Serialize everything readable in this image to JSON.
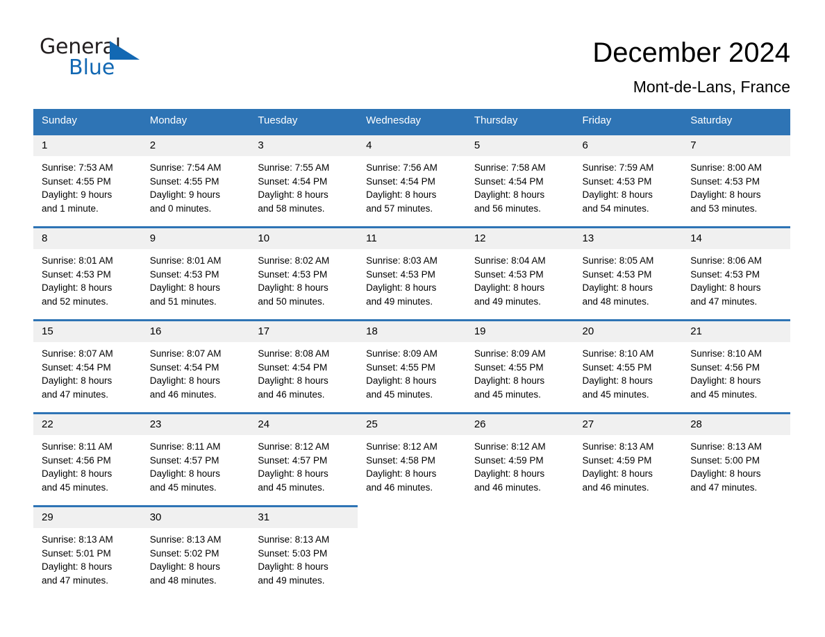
{
  "logo": {
    "word1": "General",
    "word2": "Blue",
    "triangle_color": "#1268b3"
  },
  "header": {
    "title": "December 2024",
    "subtitle": "Mont-de-Lans, France"
  },
  "theme": {
    "header_blue": "#2e74b5",
    "daynum_bg": "#f0f0f0",
    "page_bg": "#ffffff",
    "text": "#000000"
  },
  "weekdays": [
    "Sunday",
    "Monday",
    "Tuesday",
    "Wednesday",
    "Thursday",
    "Friday",
    "Saturday"
  ],
  "weeks": [
    [
      {
        "day": "1",
        "sunrise": "Sunrise: 7:53 AM",
        "sunset": "Sunset: 4:55 PM",
        "daylight1": "Daylight: 9 hours",
        "daylight2": "and 1 minute."
      },
      {
        "day": "2",
        "sunrise": "Sunrise: 7:54 AM",
        "sunset": "Sunset: 4:55 PM",
        "daylight1": "Daylight: 9 hours",
        "daylight2": "and 0 minutes."
      },
      {
        "day": "3",
        "sunrise": "Sunrise: 7:55 AM",
        "sunset": "Sunset: 4:54 PM",
        "daylight1": "Daylight: 8 hours",
        "daylight2": "and 58 minutes."
      },
      {
        "day": "4",
        "sunrise": "Sunrise: 7:56 AM",
        "sunset": "Sunset: 4:54 PM",
        "daylight1": "Daylight: 8 hours",
        "daylight2": "and 57 minutes."
      },
      {
        "day": "5",
        "sunrise": "Sunrise: 7:58 AM",
        "sunset": "Sunset: 4:54 PM",
        "daylight1": "Daylight: 8 hours",
        "daylight2": "and 56 minutes."
      },
      {
        "day": "6",
        "sunrise": "Sunrise: 7:59 AM",
        "sunset": "Sunset: 4:53 PM",
        "daylight1": "Daylight: 8 hours",
        "daylight2": "and 54 minutes."
      },
      {
        "day": "7",
        "sunrise": "Sunrise: 8:00 AM",
        "sunset": "Sunset: 4:53 PM",
        "daylight1": "Daylight: 8 hours",
        "daylight2": "and 53 minutes."
      }
    ],
    [
      {
        "day": "8",
        "sunrise": "Sunrise: 8:01 AM",
        "sunset": "Sunset: 4:53 PM",
        "daylight1": "Daylight: 8 hours",
        "daylight2": "and 52 minutes."
      },
      {
        "day": "9",
        "sunrise": "Sunrise: 8:01 AM",
        "sunset": "Sunset: 4:53 PM",
        "daylight1": "Daylight: 8 hours",
        "daylight2": "and 51 minutes."
      },
      {
        "day": "10",
        "sunrise": "Sunrise: 8:02 AM",
        "sunset": "Sunset: 4:53 PM",
        "daylight1": "Daylight: 8 hours",
        "daylight2": "and 50 minutes."
      },
      {
        "day": "11",
        "sunrise": "Sunrise: 8:03 AM",
        "sunset": "Sunset: 4:53 PM",
        "daylight1": "Daylight: 8 hours",
        "daylight2": "and 49 minutes."
      },
      {
        "day": "12",
        "sunrise": "Sunrise: 8:04 AM",
        "sunset": "Sunset: 4:53 PM",
        "daylight1": "Daylight: 8 hours",
        "daylight2": "and 49 minutes."
      },
      {
        "day": "13",
        "sunrise": "Sunrise: 8:05 AM",
        "sunset": "Sunset: 4:53 PM",
        "daylight1": "Daylight: 8 hours",
        "daylight2": "and 48 minutes."
      },
      {
        "day": "14",
        "sunrise": "Sunrise: 8:06 AM",
        "sunset": "Sunset: 4:53 PM",
        "daylight1": "Daylight: 8 hours",
        "daylight2": "and 47 minutes."
      }
    ],
    [
      {
        "day": "15",
        "sunrise": "Sunrise: 8:07 AM",
        "sunset": "Sunset: 4:54 PM",
        "daylight1": "Daylight: 8 hours",
        "daylight2": "and 47 minutes."
      },
      {
        "day": "16",
        "sunrise": "Sunrise: 8:07 AM",
        "sunset": "Sunset: 4:54 PM",
        "daylight1": "Daylight: 8 hours",
        "daylight2": "and 46 minutes."
      },
      {
        "day": "17",
        "sunrise": "Sunrise: 8:08 AM",
        "sunset": "Sunset: 4:54 PM",
        "daylight1": "Daylight: 8 hours",
        "daylight2": "and 46 minutes."
      },
      {
        "day": "18",
        "sunrise": "Sunrise: 8:09 AM",
        "sunset": "Sunset: 4:55 PM",
        "daylight1": "Daylight: 8 hours",
        "daylight2": "and 45 minutes."
      },
      {
        "day": "19",
        "sunrise": "Sunrise: 8:09 AM",
        "sunset": "Sunset: 4:55 PM",
        "daylight1": "Daylight: 8 hours",
        "daylight2": "and 45 minutes."
      },
      {
        "day": "20",
        "sunrise": "Sunrise: 8:10 AM",
        "sunset": "Sunset: 4:55 PM",
        "daylight1": "Daylight: 8 hours",
        "daylight2": "and 45 minutes."
      },
      {
        "day": "21",
        "sunrise": "Sunrise: 8:10 AM",
        "sunset": "Sunset: 4:56 PM",
        "daylight1": "Daylight: 8 hours",
        "daylight2": "and 45 minutes."
      }
    ],
    [
      {
        "day": "22",
        "sunrise": "Sunrise: 8:11 AM",
        "sunset": "Sunset: 4:56 PM",
        "daylight1": "Daylight: 8 hours",
        "daylight2": "and 45 minutes."
      },
      {
        "day": "23",
        "sunrise": "Sunrise: 8:11 AM",
        "sunset": "Sunset: 4:57 PM",
        "daylight1": "Daylight: 8 hours",
        "daylight2": "and 45 minutes."
      },
      {
        "day": "24",
        "sunrise": "Sunrise: 8:12 AM",
        "sunset": "Sunset: 4:57 PM",
        "daylight1": "Daylight: 8 hours",
        "daylight2": "and 45 minutes."
      },
      {
        "day": "25",
        "sunrise": "Sunrise: 8:12 AM",
        "sunset": "Sunset: 4:58 PM",
        "daylight1": "Daylight: 8 hours",
        "daylight2": "and 46 minutes."
      },
      {
        "day": "26",
        "sunrise": "Sunrise: 8:12 AM",
        "sunset": "Sunset: 4:59 PM",
        "daylight1": "Daylight: 8 hours",
        "daylight2": "and 46 minutes."
      },
      {
        "day": "27",
        "sunrise": "Sunrise: 8:13 AM",
        "sunset": "Sunset: 4:59 PM",
        "daylight1": "Daylight: 8 hours",
        "daylight2": "and 46 minutes."
      },
      {
        "day": "28",
        "sunrise": "Sunrise: 8:13 AM",
        "sunset": "Sunset: 5:00 PM",
        "daylight1": "Daylight: 8 hours",
        "daylight2": "and 47 minutes."
      }
    ],
    [
      {
        "day": "29",
        "sunrise": "Sunrise: 8:13 AM",
        "sunset": "Sunset: 5:01 PM",
        "daylight1": "Daylight: 8 hours",
        "daylight2": "and 47 minutes."
      },
      {
        "day": "30",
        "sunrise": "Sunrise: 8:13 AM",
        "sunset": "Sunset: 5:02 PM",
        "daylight1": "Daylight: 8 hours",
        "daylight2": "and 48 minutes."
      },
      {
        "day": "31",
        "sunrise": "Sunrise: 8:13 AM",
        "sunset": "Sunset: 5:03 PM",
        "daylight1": "Daylight: 8 hours",
        "daylight2": "and 49 minutes."
      },
      {
        "day": "",
        "sunrise": "",
        "sunset": "",
        "daylight1": "",
        "daylight2": ""
      },
      {
        "day": "",
        "sunrise": "",
        "sunset": "",
        "daylight1": "",
        "daylight2": ""
      },
      {
        "day": "",
        "sunrise": "",
        "sunset": "",
        "daylight1": "",
        "daylight2": ""
      },
      {
        "day": "",
        "sunrise": "",
        "sunset": "",
        "daylight1": "",
        "daylight2": ""
      }
    ]
  ]
}
